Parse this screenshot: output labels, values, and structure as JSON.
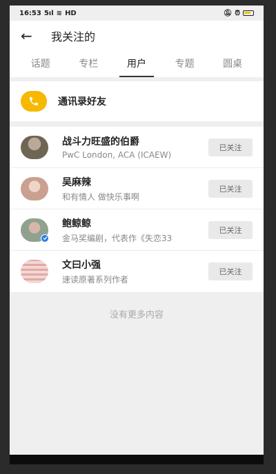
{
  "status_bar": {
    "time": "16:53",
    "signal_text": "5ıl",
    "network": "HD"
  },
  "header": {
    "title": "我关注的"
  },
  "tabs": [
    {
      "label": "话题"
    },
    {
      "label": "专栏"
    },
    {
      "label": "用户",
      "active": true
    },
    {
      "label": "专题"
    },
    {
      "label": "圆桌"
    }
  ],
  "contacts": {
    "label": "通讯录好友"
  },
  "users": [
    {
      "name": "战斗力旺盛的伯爵",
      "desc": "PwC London, ACA (ICAEW)",
      "button": "已关注",
      "avatar_color": "#7c7060",
      "verified": false
    },
    {
      "name": "吴麻辣",
      "desc": "和有情人 做快乐事啊",
      "button": "已关注",
      "avatar_color": "#d9b4a8",
      "verified": false
    },
    {
      "name": "鲍鲸鲸",
      "desc": "金马奖编剧，代表作《失恋33",
      "button": "已关注",
      "avatar_color": "#c9a49a",
      "verified": true
    },
    {
      "name": "文曰小强",
      "desc": "速读原著系列作者",
      "button": "已关注",
      "avatar_color": "#e7c2c0",
      "verified": false
    }
  ],
  "footer": {
    "no_more": "没有更多内容"
  },
  "colors": {
    "accent": "#f6b800",
    "verified": "#2e7fe8"
  }
}
